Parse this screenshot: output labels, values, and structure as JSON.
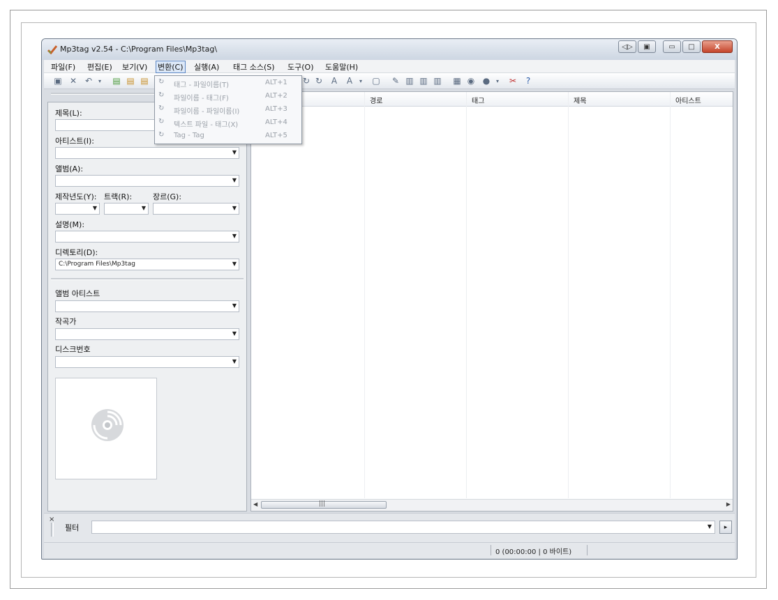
{
  "window": {
    "title": "Mp3tag v2.54  -  C:\\Program Files\\Mp3tag\\"
  },
  "window_buttons": [
    "◁▷",
    "▣",
    "▭",
    "□",
    "X"
  ],
  "menubar": {
    "items": [
      {
        "label": "파일(F)"
      },
      {
        "label": "편집(E)"
      },
      {
        "label": "보기(V)"
      },
      {
        "label": "변환(C)"
      },
      {
        "label": "실행(A)"
      },
      {
        "label": "태그 소스(S)"
      },
      {
        "label": "도구(O)"
      },
      {
        "label": "도움말(H)"
      }
    ]
  },
  "convert_menu": {
    "items": [
      {
        "label": "태그 - 파일이름(T)",
        "shortcut": "ALT+1"
      },
      {
        "label": "파일이름 - 태그(F)",
        "shortcut": "ALT+2"
      },
      {
        "label": "파일이름 - 파일이름(I)",
        "shortcut": "ALT+3"
      },
      {
        "label": "텍스트 파일 - 태그(X)",
        "shortcut": "ALT+4"
      },
      {
        "label": "Tag - Tag",
        "shortcut": "ALT+5"
      }
    ]
  },
  "tag_panel": {
    "title_label": "제목(L):",
    "artist_label": "아티스트(I):",
    "album_label": "앨범(A):",
    "year_label": "제작년도(Y):",
    "track_label": "트랙(R):",
    "genre_label": "장르(G):",
    "comment_label": "설명(M):",
    "directory_label": "디렉토리(D):",
    "directory_value": "C:\\Program Files\\Mp3tag",
    "album_artist_label": "앨범 아티스트",
    "composer_label": "작곡가",
    "discnumber_label": "디스크번호"
  },
  "file_list": {
    "columns": [
      "경로",
      "태그",
      "제목",
      "아티스트"
    ],
    "rows": []
  },
  "filter": {
    "label": "필터",
    "value": ""
  },
  "status": {
    "text": "0 (00:00:00 | 0 바이트)"
  },
  "colors": {
    "accent": "#5b86c4",
    "title_gradient_top": "#e9eef5",
    "close_button": "#c4452b"
  }
}
